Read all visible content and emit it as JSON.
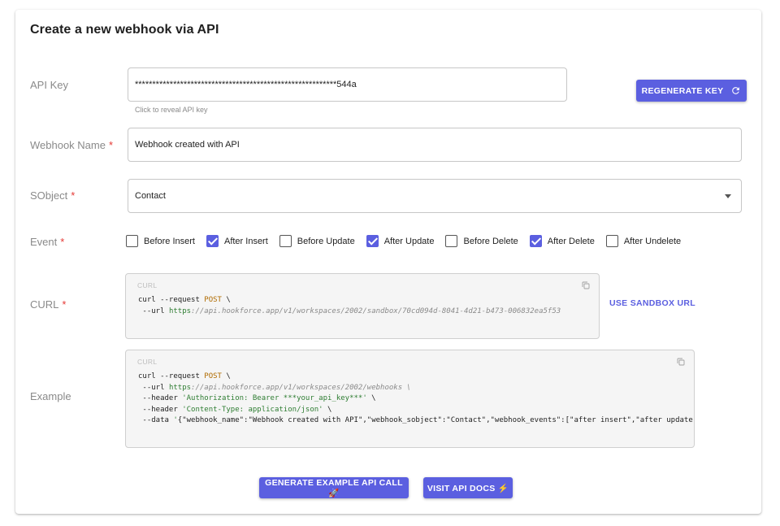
{
  "card": {
    "title": "Create a new webhook via API"
  },
  "api_key": {
    "label": "API Key",
    "value": "**********************************************************544a",
    "helper": "Click to reveal API key",
    "regenerate_label": "REGENERATE KEY"
  },
  "webhook_name": {
    "label": "Webhook Name",
    "required": "*",
    "value": "Webhook created with API"
  },
  "sobject": {
    "label": "SObject",
    "required": "*",
    "value": "Contact"
  },
  "event": {
    "label": "Event",
    "required": "*",
    "options": [
      {
        "label": "Before Insert",
        "checked": false
      },
      {
        "label": "After Insert",
        "checked": true
      },
      {
        "label": "Before Update",
        "checked": false
      },
      {
        "label": "After Update",
        "checked": true
      },
      {
        "label": "Before Delete",
        "checked": false
      },
      {
        "label": "After Delete",
        "checked": true
      },
      {
        "label": "After Undelete",
        "checked": false
      }
    ]
  },
  "curl": {
    "label": "CURL",
    "required": "*",
    "caption": "CURL",
    "line1_cmd": "curl --request ",
    "line1_method": "POST",
    "line1_end": " \\",
    "line2_flag": " --url ",
    "line2_scheme": "https",
    "line2_path": "://api.hookforce.app/v1/workspaces/2002/sandbox/70cd094d-8041-4d21-b473-006832ea5f53",
    "sandbox_label": "USE SANDBOX URL"
  },
  "example": {
    "label": "Example",
    "caption": "CURL",
    "line1_cmd": "curl --request ",
    "line1_method": "POST",
    "line1_end": " \\",
    "line2_flag": " --url ",
    "line2_scheme": "https",
    "line2_path": "://api.hookforce.app/v1/workspaces/2002/webhooks",
    "line2_end": " \\",
    "line3_flag": " --header ",
    "line3_str": "'Authorization: Bearer ***your_api_key***'",
    "line3_end": " \\",
    "line4_flag": " --header ",
    "line4_str": "'Content-Type: application/json'",
    "line4_end": " \\",
    "line5_flag": " --data ",
    "line5_str": "'",
    "line5_json": "{\"webhook_name\":\"Webhook created with API\",\"webhook_sobject\":\"Contact\",\"webhook_events\":[\"after insert\",\"after update\","
  },
  "actions": {
    "generate_label": "GENERATE EXAMPLE API CALL 🚀",
    "docs_label": "VISIT API DOCS ⚡"
  },
  "colors": {
    "accent": "#5b5fe0",
    "required": "#e53935"
  },
  "icons": {
    "refresh": "refresh-icon",
    "copy": "copy-icon",
    "dropdown": "chevron-down-icon"
  }
}
